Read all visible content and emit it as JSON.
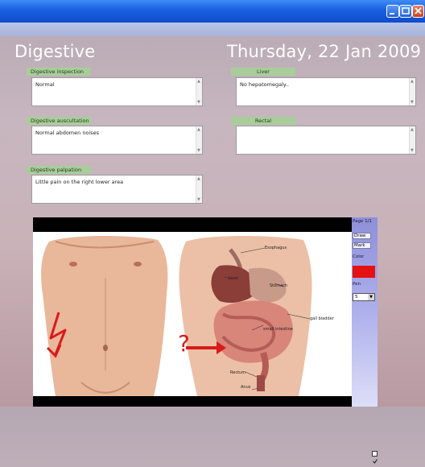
{
  "header": {
    "section_title": "Digestive",
    "date": "Thursday, 22 Jan 2009"
  },
  "fields": {
    "digestive_inspection": {
      "label": "Digestive inspection",
      "value": "Normal"
    },
    "digestive_auscultation": {
      "label": "Digestive auscultation",
      "value": "Normal abdomen noises"
    },
    "digestive_palpation": {
      "label": "Digestive palpation",
      "value": "Little pain on the right lower area"
    },
    "liver": {
      "label": "Liver",
      "value": "No hepatomegaly.."
    },
    "rectal": {
      "label": "Rectal",
      "value": ""
    }
  },
  "image": {
    "labels": {
      "esophagus": "Esophagus",
      "liver": "Liver",
      "stomach": "Stomach",
      "gall_bladder": "gall bladder",
      "small_intestine": "small intestine",
      "rectum": "Rectum",
      "anus": "Anus"
    },
    "annotation_mark": "?"
  },
  "tools": {
    "page": "Page 1/1",
    "draw": "Draw",
    "mark": "Mark",
    "color_label": "Color",
    "pen_label": "Pen",
    "pen_value": "5",
    "draw_checked": true,
    "selected_color": "#e41212"
  },
  "colors": {
    "titlebar": "#1a5fe0",
    "label_bar": "#a9cd9a",
    "annotation": "#d81b1b"
  }
}
